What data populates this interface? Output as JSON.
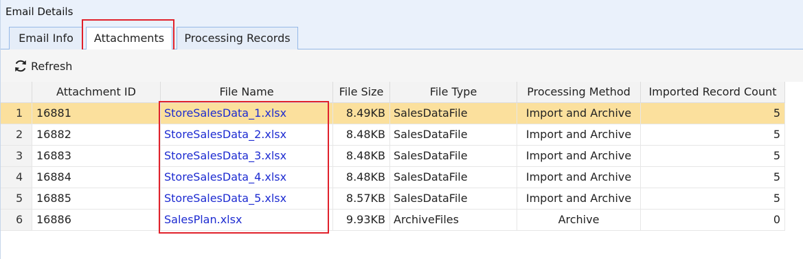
{
  "panel": {
    "title": "Email Details"
  },
  "tabs": [
    {
      "label": "Email Info",
      "active": false
    },
    {
      "label": "Attachments",
      "active": true
    },
    {
      "label": "Processing Records",
      "active": false
    }
  ],
  "toolbar": {
    "refresh_label": "Refresh",
    "refresh_icon": "refresh-icon"
  },
  "table": {
    "columns": [
      "",
      "Attachment ID",
      "File Name",
      "File Size",
      "File Type",
      "Processing Method",
      "Imported Record Count"
    ],
    "rows": [
      {
        "num": "1",
        "id": "16881",
        "name": "StoreSalesData_1.xlsx",
        "size": "8.49KB",
        "type": "SalesDataFile",
        "method": "Import and Archive",
        "count": "5",
        "selected": true
      },
      {
        "num": "2",
        "id": "16882",
        "name": "StoreSalesData_2.xlsx",
        "size": "8.48KB",
        "type": "SalesDataFile",
        "method": "Import and Archive",
        "count": "5"
      },
      {
        "num": "3",
        "id": "16883",
        "name": "StoreSalesData_3.xlsx",
        "size": "8.48KB",
        "type": "SalesDataFile",
        "method": "Import and Archive",
        "count": "5"
      },
      {
        "num": "4",
        "id": "16884",
        "name": "StoreSalesData_4.xlsx",
        "size": "8.48KB",
        "type": "SalesDataFile",
        "method": "Import and Archive",
        "count": "5"
      },
      {
        "num": "5",
        "id": "16885",
        "name": "StoreSalesData_5.xlsx",
        "size": "8.57KB",
        "type": "SalesDataFile",
        "method": "Import and Archive",
        "count": "5"
      },
      {
        "num": "6",
        "id": "16886",
        "name": "SalesPlan.xlsx",
        "size": "9.93KB",
        "type": "ArchiveFiles",
        "method": "Archive",
        "count": "0"
      }
    ]
  },
  "colors": {
    "selected_row": "#fbe09d",
    "link": "#1d2bd1",
    "highlight_box": "#e0202a",
    "header_bg": "#eaf1fb"
  }
}
